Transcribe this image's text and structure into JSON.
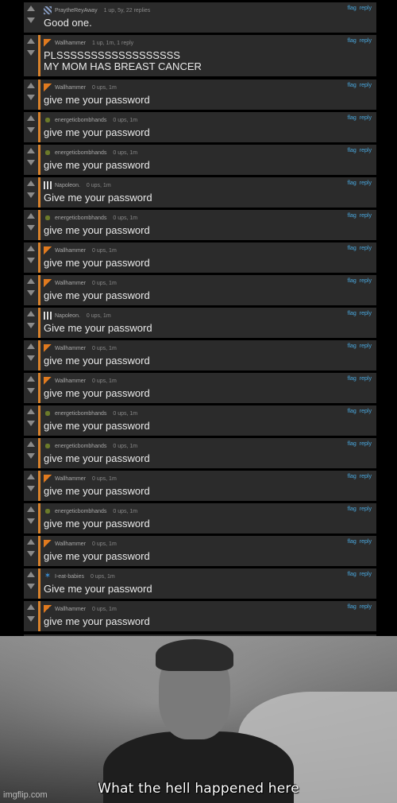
{
  "colors": {
    "background": "#000000",
    "comment_bg": "#2b2b2b",
    "reply_bar": "#d9822b",
    "link": "#4aa9e0",
    "text": "#eaeaea"
  },
  "actions": {
    "flag": "flag",
    "reply": "reply"
  },
  "comments": [
    {
      "avatar": "pray-avatar",
      "user": "PraytheReyAway",
      "meta": "1 up, 5y, 22 replies",
      "body": "Good one."
    },
    {
      "avatar": "hammer-avatar",
      "user": "Wallhammer",
      "meta": "1 up, 1m, 1 reply",
      "body": "PLSSSSSSSSSSSSSSSSSS\nMY MOM HAS BREAST CANCER"
    },
    {
      "avatar": "hammer-avatar",
      "user": "Wallhammer",
      "meta": "0 ups, 1m",
      "body": "give me your password"
    },
    {
      "avatar": "bomb-avatar",
      "user": "energeticbombhands",
      "meta": "0 ups, 1m",
      "body": "give me your password"
    },
    {
      "avatar": "bomb-avatar",
      "user": "energeticbombhands",
      "meta": "0 ups, 1m",
      "body": "give me your password"
    },
    {
      "avatar": "napoleon-avatar",
      "user": "Napoleon.",
      "meta": "0 ups, 1m",
      "body": "Give me your password"
    },
    {
      "avatar": "bomb-avatar",
      "user": "energeticbombhands",
      "meta": "0 ups, 1m",
      "body": "give me your password"
    },
    {
      "avatar": "hammer-avatar",
      "user": "Wallhammer",
      "meta": "0 ups, 1m",
      "body": "give me your password"
    },
    {
      "avatar": "hammer-avatar",
      "user": "Wallhammer",
      "meta": "0 ups, 1m",
      "body": "give me your password"
    },
    {
      "avatar": "napoleon-avatar",
      "user": "Napoleon.",
      "meta": "0 ups, 1m",
      "body": "Give me your password"
    },
    {
      "avatar": "hammer-avatar",
      "user": "Wallhammer",
      "meta": "0 ups, 1m",
      "body": "give me your password"
    },
    {
      "avatar": "hammer-avatar",
      "user": "Wallhammer",
      "meta": "0 ups, 1m",
      "body": "give me your password"
    },
    {
      "avatar": "bomb-avatar",
      "user": "energeticbombhands",
      "meta": "0 ups, 1m",
      "body": "give me your password"
    },
    {
      "avatar": "bomb-avatar",
      "user": "energeticbombhands",
      "meta": "0 ups, 1m",
      "body": "give me your password"
    },
    {
      "avatar": "hammer-avatar",
      "user": "Wallhammer",
      "meta": "0 ups, 1m",
      "body": "give me your password"
    },
    {
      "avatar": "bomb-avatar",
      "user": "energeticbombhands",
      "meta": "0 ups, 1m",
      "body": "give me your password"
    },
    {
      "avatar": "hammer-avatar",
      "user": "Wallhammer",
      "meta": "0 ups, 1m",
      "body": "give me your password"
    },
    {
      "avatar": "babies-avatar",
      "user": "I-eat-babies",
      "meta": "0 ups, 1m",
      "body": "Give me your password"
    },
    {
      "avatar": "hammer-avatar",
      "user": "Wallhammer",
      "meta": "0 ups, 1m",
      "body": "give me your password"
    }
  ],
  "meme": {
    "caption": "What the hell happened here",
    "watermark": "imgflip.com"
  }
}
